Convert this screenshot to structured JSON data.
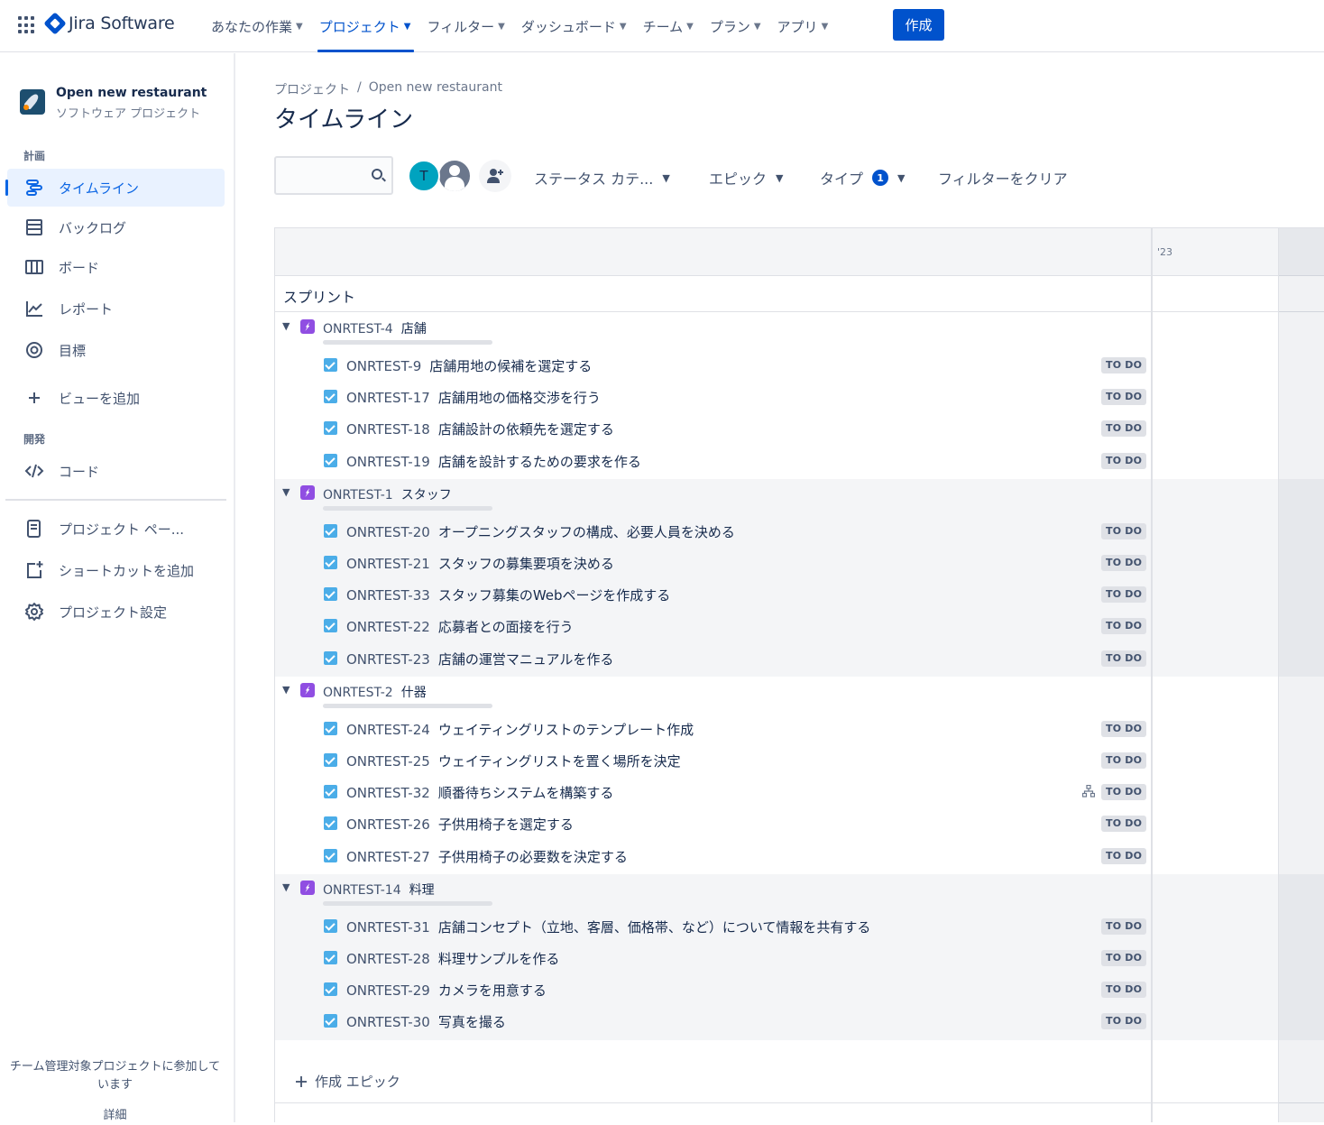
{
  "app": {
    "brand": "Jira Software"
  },
  "topnav": {
    "menus": [
      {
        "label": "あなたの作業",
        "active": false
      },
      {
        "label": "プロジェクト",
        "active": true
      },
      {
        "label": "フィルター",
        "active": false
      },
      {
        "label": "ダッシュボード",
        "active": false
      },
      {
        "label": "チーム",
        "active": false
      },
      {
        "label": "プラン",
        "active": false
      },
      {
        "label": "アプリ",
        "active": false
      }
    ],
    "create_label": "作成"
  },
  "sidebar": {
    "project_name": "Open new restaurant",
    "project_type": "ソフトウェア プロジェクト",
    "section_plan": "計画",
    "section_dev": "開発",
    "items": [
      {
        "label": "タイムライン",
        "icon": "timeline-icon",
        "active": true
      },
      {
        "label": "バックログ",
        "icon": "backlog-icon"
      },
      {
        "label": "ボード",
        "icon": "board-icon"
      },
      {
        "label": "レポート",
        "icon": "reports-icon"
      },
      {
        "label": "目標",
        "icon": "goals-icon"
      },
      {
        "label": "ビューを追加",
        "icon": "plus-icon"
      },
      {
        "label": "コード",
        "icon": "code-icon"
      },
      {
        "label": "プロジェクト ペー...",
        "icon": "page-icon"
      },
      {
        "label": "ショートカットを追加",
        "icon": "add-shortcut-icon"
      },
      {
        "label": "プロジェクト設定",
        "icon": "gear-icon"
      }
    ],
    "footer_text": "チーム管理対象プロジェクトに参加しています",
    "footer_link": "詳細"
  },
  "main": {
    "breadcrumb": {
      "root": "プロジェクト",
      "separator": "/",
      "project": "Open new restaurant"
    },
    "title": "タイムライン",
    "search_placeholder": "",
    "avatar_initial": "T",
    "filters": {
      "status": "ステータス カテ...",
      "epic": "エピック",
      "type": "タイプ",
      "type_count": "1",
      "clear": "フィルターをクリア"
    }
  },
  "timeline": {
    "year_label": "'23",
    "sprint_label": "スプリント",
    "create_epic_label": "作成 エピック",
    "epics": [
      {
        "key": "ONRTEST-4",
        "name": "店舗",
        "issues": [
          {
            "key": "ONRTEST-9",
            "summary": "店舗用地の候補を選定する",
            "status": "TO DO"
          },
          {
            "key": "ONRTEST-17",
            "summary": "店舗用地の価格交渉を行う",
            "status": "TO DO"
          },
          {
            "key": "ONRTEST-18",
            "summary": "店舗設計の依頼先を選定する",
            "status": "TO DO"
          },
          {
            "key": "ONRTEST-19",
            "summary": "店舗を設計するための要求を作る",
            "status": "TO DO"
          }
        ]
      },
      {
        "key": "ONRTEST-1",
        "name": "スタッフ",
        "issues": [
          {
            "key": "ONRTEST-20",
            "summary": "オープニングスタッフの構成、必要人員を決める",
            "status": "TO DO"
          },
          {
            "key": "ONRTEST-21",
            "summary": "スタッフの募集要項を決める",
            "status": "TO DO"
          },
          {
            "key": "ONRTEST-33",
            "summary": "スタッフ募集のWebページを作成する",
            "status": "TO DO"
          },
          {
            "key": "ONRTEST-22",
            "summary": "応募者との面接を行う",
            "status": "TO DO"
          },
          {
            "key": "ONRTEST-23",
            "summary": "店舗の運営マニュアルを作る",
            "status": "TO DO"
          }
        ]
      },
      {
        "key": "ONRTEST-2",
        "name": "什器",
        "issues": [
          {
            "key": "ONRTEST-24",
            "summary": "ウェイティングリストのテンプレート作成",
            "status": "TO DO"
          },
          {
            "key": "ONRTEST-25",
            "summary": "ウェイティングリストを置く場所を決定",
            "status": "TO DO"
          },
          {
            "key": "ONRTEST-32",
            "summary": "順番待ちシステムを構築する",
            "status": "TO DO",
            "has_children": true
          },
          {
            "key": "ONRTEST-26",
            "summary": "子供用椅子を選定する",
            "status": "TO DO"
          },
          {
            "key": "ONRTEST-27",
            "summary": "子供用椅子の必要数を決定する",
            "status": "TO DO"
          }
        ]
      },
      {
        "key": "ONRTEST-14",
        "name": "料理",
        "issues": [
          {
            "key": "ONRTEST-31",
            "summary": "店舗コンセプト（立地、客層、価格帯、など）について情報を共有する",
            "status": "TO DO"
          },
          {
            "key": "ONRTEST-28",
            "summary": "料理サンプルを作る",
            "status": "TO DO"
          },
          {
            "key": "ONRTEST-29",
            "summary": "カメラを用意する",
            "status": "TO DO"
          },
          {
            "key": "ONRTEST-30",
            "summary": "写真を撮る",
            "status": "TO DO"
          }
        ]
      }
    ]
  },
  "colors": {
    "accent": "#0052cc",
    "epic": "#904ee2",
    "task": "#4bade8",
    "active_nav_bg": "#e9f2ff"
  }
}
